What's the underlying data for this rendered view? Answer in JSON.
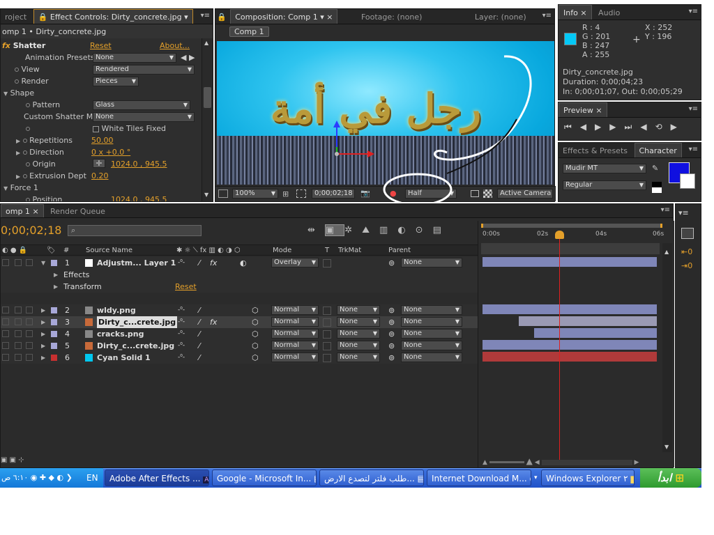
{
  "effect_panel": {
    "tab_project": "roject",
    "tab_effect_controls": "Effect Controls: Dirty_concrete.jpg",
    "breadcrumb": "omp 1 • Dirty_concrete.jpg",
    "effect_name": "Shatter",
    "reset": "Reset",
    "about": "About...",
    "props": {
      "anim_presets_label": "Animation Presets:",
      "anim_presets_value": "None",
      "view_label": "View",
      "view_value": "Rendered",
      "render_label": "Render",
      "render_value": "Pieces",
      "shape_label": "Shape",
      "pattern_label": "Pattern",
      "pattern_value": "Glass",
      "custom_label": "Custom Shatter Ma",
      "custom_value": "None",
      "white_tiles_label": "White Tiles Fixed",
      "repetitions_label": "Repetitions",
      "repetitions_value": "50.00",
      "direction_label": "Direction",
      "direction_value": "0 x +0.0 °",
      "origin_label": "Origin",
      "origin_value": "1024.0 , 945.5",
      "extrusion_label": "Extrusion Dept",
      "extrusion_value": "0.20",
      "force_label": "Force 1",
      "position_label": "Position",
      "position_value": "1024.0 , 945.5"
    }
  },
  "comp_panel": {
    "tab_composition": "Composition: Comp 1",
    "tab_footage": "Footage: (none)",
    "tab_layer": "Layer: (none)",
    "comp_button": "Comp 1",
    "arabic_text": "رجل في أمة",
    "zoom": "100%",
    "timecode": "0;00;02;18",
    "resolution": "Half",
    "camera": "Active Camera"
  },
  "info_panel": {
    "tab_info": "Info",
    "tab_audio": "Audio",
    "r": "R : 4",
    "g": "G : 201",
    "b": "B : 247",
    "a": "A : 255",
    "x": "X : 252",
    "y": "Y : 196",
    "file": "Dirty_concrete.jpg",
    "duration": "Duration: 0;00;04;23",
    "inout": "In: 0;00;01;07, Out: 0;00;05;29",
    "swatch_color": "#04C9F7"
  },
  "preview_panel": {
    "tab_preview": "Preview"
  },
  "char_panel": {
    "tab_effects": "Effects & Presets",
    "tab_character": "Character",
    "font": "Mudir MT",
    "style": "Regular",
    "fill_color": "#1010E0"
  },
  "timeline": {
    "tab_comp": "omp 1",
    "tab_render": "Render Queue",
    "timecode": "0;00;02;18",
    "search_placeholder": "",
    "headers": {
      "num": "#",
      "source": "Source Name",
      "mode": "Mode",
      "t": "T",
      "trkmat": "TrkMat",
      "parent": "Parent"
    },
    "ruler": [
      "0:00s",
      "02s",
      "04s",
      "06s"
    ],
    "layers": [
      {
        "num": "1",
        "name": "Adjustm... Layer 1",
        "mode": "Overlay",
        "trkmat": "",
        "parent": "None",
        "label": "#a8a8d8",
        "icon": "#ffffff"
      },
      {
        "num": "2",
        "name": "wldy.png",
        "mode": "Normal",
        "trkmat": "None",
        "parent": "None",
        "label": "#a8a8d8",
        "icon": "#888888"
      },
      {
        "num": "3",
        "name": "Dirty_c...crete.jpg",
        "mode": "Normal",
        "trkmat": "None",
        "parent": "None",
        "label": "#a8a8d8",
        "icon": "#c86a3a"
      },
      {
        "num": "4",
        "name": "cracks.png",
        "mode": "Normal",
        "trkmat": "None",
        "parent": "None",
        "label": "#a8a8d8",
        "icon": "#888888"
      },
      {
        "num": "5",
        "name": "Dirty_c...crete.jpg",
        "mode": "Normal",
        "trkmat": "None",
        "parent": "None",
        "label": "#a8a8d8",
        "icon": "#c86a3a"
      },
      {
        "num": "6",
        "name": "Cyan Solid 1",
        "mode": "Normal",
        "trkmat": "None",
        "parent": "None",
        "label": "#c83030",
        "icon": "#00c8f0"
      }
    ],
    "sub_effects": "Effects",
    "sub_transform": "Transform",
    "sub_reset": "Reset"
  },
  "taskbar": {
    "clock": "٦:١٠ ص",
    "lang": "EN",
    "items": [
      "Adobe After Effects ...",
      "Google - Microsoft In...",
      "طلب فلتر لتصدع الارض...",
      "Internet Download M...",
      "Windows Explorer ٢"
    ],
    "start": "ابدأ"
  }
}
